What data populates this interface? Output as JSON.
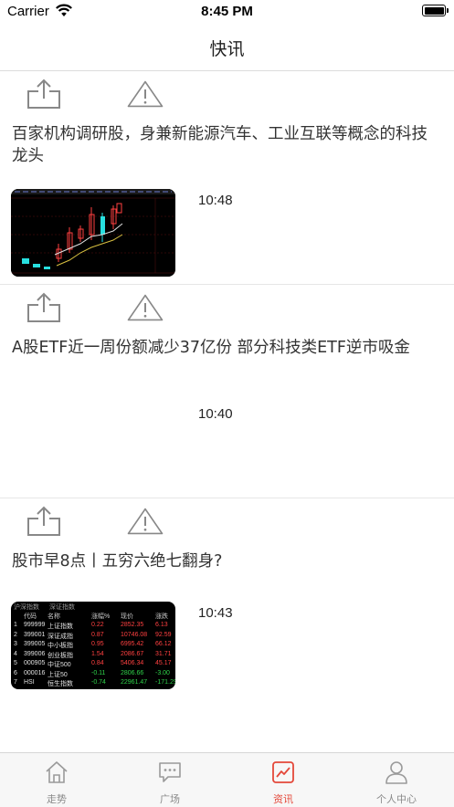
{
  "status_bar": {
    "carrier": "Carrier",
    "time": "8:45 PM"
  },
  "nav": {
    "title": "快讯"
  },
  "news": [
    {
      "headline": "百家机构调研股，身兼新能源汽车、工业互联等概念的科技龙头",
      "time": "10:48",
      "thumbnail": "candlestick-chart"
    },
    {
      "headline": "A股ETF近一周份额减少37亿份 部分科技类ETF逆市吸金",
      "time": "10:40",
      "thumbnail": ""
    },
    {
      "headline": "股市早8点丨五穷六绝七翻身?",
      "time": "10:43",
      "thumbnail": "stock-table"
    }
  ],
  "stock_thumb": {
    "tabs": [
      "沪深指数",
      "深证指数"
    ],
    "headers": [
      "代码",
      "名称",
      "涨幅%",
      "现价",
      "涨跌"
    ],
    "rows": [
      [
        "1",
        "999999",
        "上证指数",
        "0.22",
        "2852.35",
        "6.13"
      ],
      [
        "2",
        "399001",
        "深证成指",
        "0.87",
        "10746.08",
        "92.59"
      ],
      [
        "3",
        "399005",
        "中小板指",
        "0.95",
        "6995.42",
        "66.12"
      ],
      [
        "4",
        "399006",
        "创业板指",
        "1.54",
        "2086.67",
        "31.71"
      ],
      [
        "5",
        "000905",
        "中证500",
        "0.84",
        "5406.34",
        "45.17"
      ],
      [
        "6",
        "000016",
        "上证50",
        "-0.11",
        "2806.66",
        "-3.00"
      ],
      [
        "7",
        "HSI",
        "恒生指数",
        "-0.74",
        "22961.47",
        "-171.29"
      ]
    ],
    "colors": {
      "up": "#ff4040",
      "down": "#2fd34a",
      "text": "#e0e0e0",
      "header": "#c8c8c8"
    }
  },
  "tabs": [
    {
      "label": "走势",
      "icon": "home-icon",
      "active": false
    },
    {
      "label": "广场",
      "icon": "chat-bubble-icon",
      "active": false
    },
    {
      "label": "资讯",
      "icon": "trend-chart-icon",
      "active": true
    },
    {
      "label": "个人中心",
      "icon": "person-icon",
      "active": false
    }
  ],
  "accent_color": "#e4483a"
}
